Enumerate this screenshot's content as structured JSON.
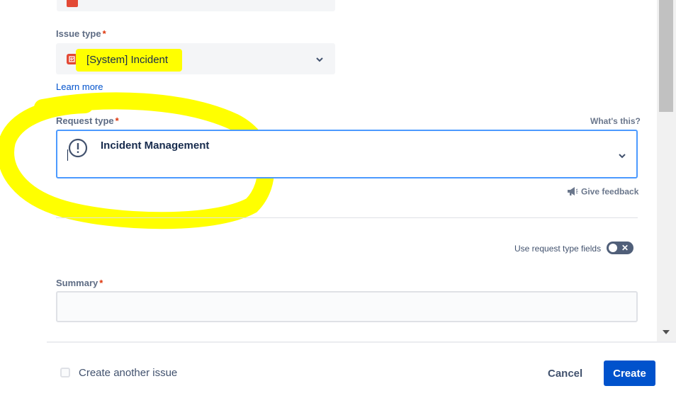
{
  "issue_type": {
    "label": "Issue type",
    "required": "*",
    "value": "[System] Incident",
    "learn_more": "Learn more"
  },
  "request_type": {
    "label": "Request type",
    "required": "*",
    "whats_this": "What's this?",
    "value": "Incident Management",
    "give_feedback": "Give feedback"
  },
  "toggle": {
    "label": "Use request type fields",
    "state": "off"
  },
  "summary": {
    "label": "Summary",
    "required": "*",
    "value": ""
  },
  "footer": {
    "create_another_label": "Create another issue",
    "cancel_label": "Cancel",
    "create_label": "Create"
  },
  "annotations": {
    "highlight_color": "#ffff00"
  },
  "colors": {
    "accent": "#0052cc",
    "required": "#de350b",
    "incident_icon": "#e34935"
  }
}
